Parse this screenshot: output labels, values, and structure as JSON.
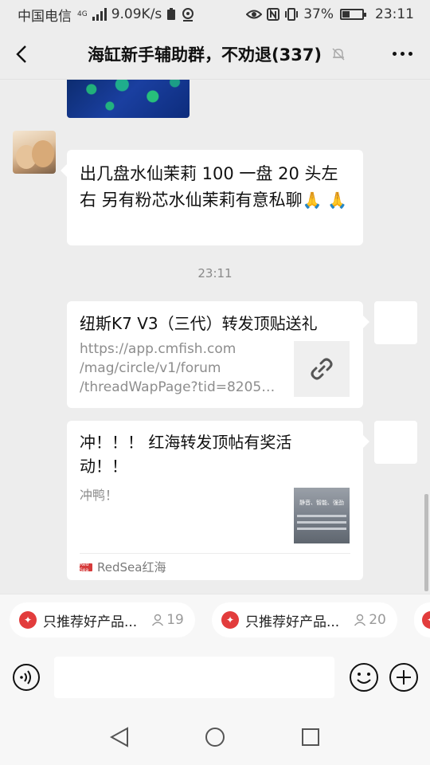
{
  "status_bar": {
    "carrier": "中国电信",
    "network_badge": "4G",
    "speed": "9.09K/s",
    "battery": "37%",
    "battery_level": 0.37,
    "time": "23:11"
  },
  "header": {
    "title": "海缸新手辅助群，不劝退(337)",
    "back_icon": "chevron-left-icon",
    "mute_icon": "bell-muted-icon",
    "more_icon": "more-dots-icon"
  },
  "messages": {
    "text_message": {
      "text": "出几盘水仙茉莉 100 一盘 20 头左右  另有粉芯水仙茉莉有意私聊",
      "emoji": "🙏",
      "emoji_name": "pray-hands-emoji"
    },
    "timestamp": "23:11",
    "link_card": {
      "title": "纽斯K7 V3（三代）转发顶贴送礼",
      "url_lines": [
        "https://app.cmfish.com",
        "/mag/circle/v1/forum",
        "/threadWapPage?tid=8205…"
      ],
      "thumb_icon": "link-icon"
    },
    "article_card": {
      "title": "冲！！！ 红海转发顶帖有奖活动！！",
      "description": "冲鸭！",
      "thumb_text": "静音、智能、强劲",
      "source": "RedSea红海",
      "source_logo_text": "Red Sea"
    }
  },
  "pinned": [
    {
      "label": "只推荐好产品...",
      "count": "19"
    },
    {
      "label": "只推荐好产品...",
      "count": "20"
    }
  ],
  "input_bar": {
    "voice_icon": "voice-icon",
    "input_value": "",
    "emoji_icon": "emoji-icon",
    "plus_icon": "plus-icon"
  },
  "nav": {
    "back": "nav-back-icon",
    "home": "nav-home-icon",
    "recents": "nav-recents-icon"
  },
  "colors": {
    "background": "#ededed",
    "bubble": "#ffffff",
    "accent_red": "#e23c3c"
  }
}
